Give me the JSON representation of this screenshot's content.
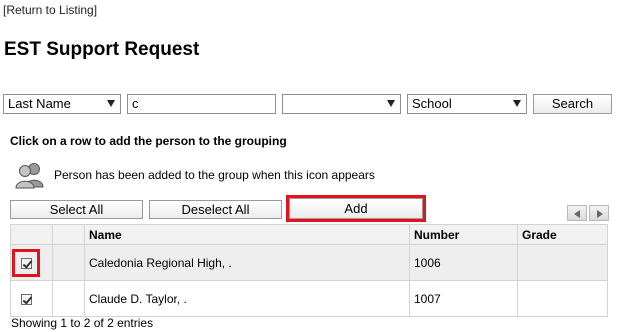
{
  "nav": {
    "return_label": "[Return to Listing]"
  },
  "page": {
    "title": "EST Support Request"
  },
  "search": {
    "field_select": "Last Name",
    "query_value": "c",
    "second_select": "",
    "scope_select": "School",
    "search_button": "Search"
  },
  "instructions": {
    "text": "Click on a row to add the person to the grouping",
    "legend_text": "Person has been added to the group when this icon appears"
  },
  "actions": {
    "select_all": "Select All",
    "deselect_all": "Deselect All",
    "add": "Add"
  },
  "table": {
    "columns": [
      "Name",
      "Number",
      "Grade"
    ],
    "rows": [
      {
        "checked": true,
        "name": "Caledonia Regional High, .",
        "number": "1006",
        "grade": ""
      },
      {
        "checked": true,
        "name": "Claude D. Taylor, .",
        "number": "1007",
        "grade": ""
      }
    ]
  },
  "footer": {
    "info": "Showing 1 to 2 of 2 entries"
  },
  "icons": {
    "legend_icon": "people-group-icon",
    "pager_prev": "triangle-left-icon",
    "pager_next": "triangle-right-icon",
    "dropdown": "chevron-down-icon"
  },
  "colors": {
    "highlight": "#e0141e",
    "row_shade": "#eeeeee"
  }
}
